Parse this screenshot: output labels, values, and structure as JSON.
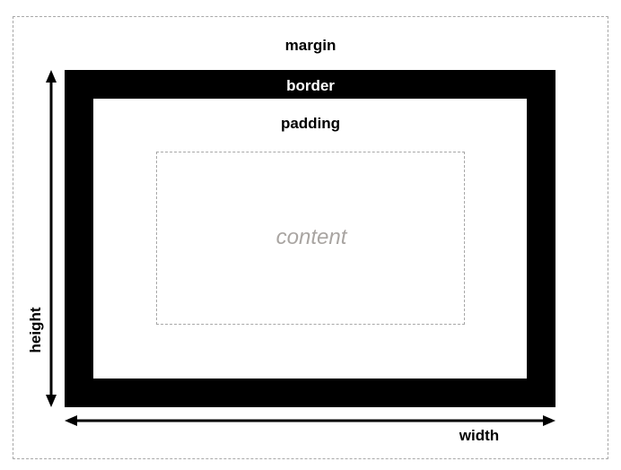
{
  "diagram": {
    "margin_label": "margin",
    "border_label": "border",
    "padding_label": "padding",
    "content_label": "content",
    "width_label": "width",
    "height_label": "height"
  },
  "colors": {
    "border_fill": "#000000",
    "content_text": "#a9a5a2",
    "dashed_line": "#a8a8a8"
  }
}
